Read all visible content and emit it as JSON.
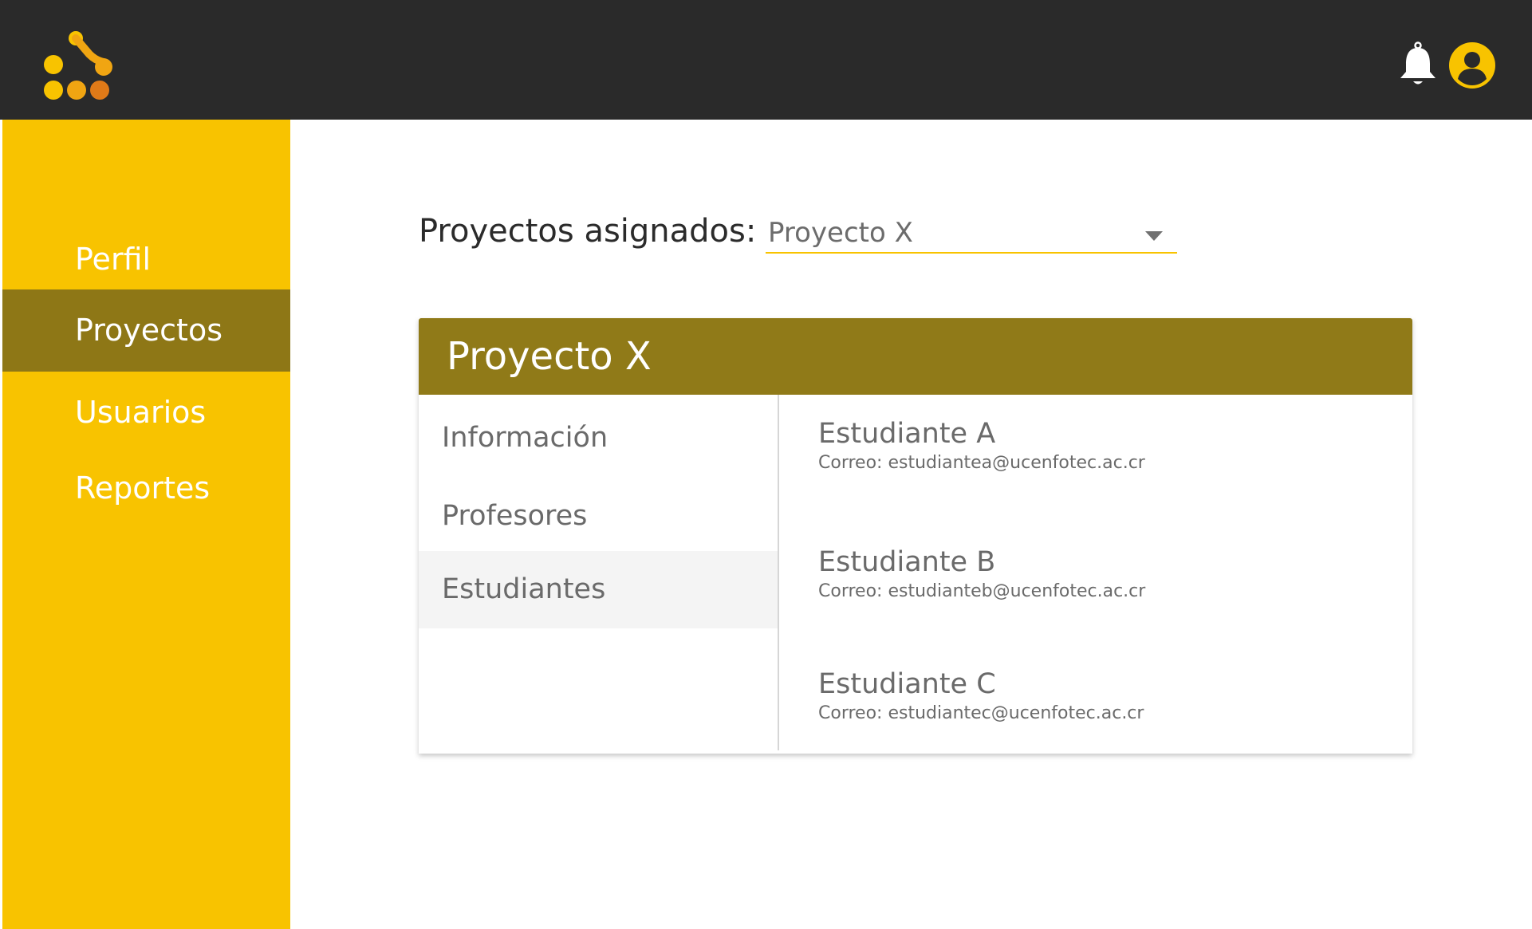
{
  "colors": {
    "topbar": "#2a2a2a",
    "sidebar": "#f8c300",
    "sidebar_active": "#8e7716",
    "card_header": "#907a18",
    "accent": "#f8c300"
  },
  "header": {
    "logo_icon": "app-logo-dots",
    "notification_icon": "bell-icon",
    "user_icon": "user-avatar-icon"
  },
  "sidebar": {
    "items": [
      {
        "label": "Perfil",
        "active": false
      },
      {
        "label": "Proyectos",
        "active": true
      },
      {
        "label": "Usuarios",
        "active": false
      },
      {
        "label": "Reportes",
        "active": false
      }
    ]
  },
  "main": {
    "projects_label": "Proyectos asignados:",
    "project_select": {
      "value": "Proyecto X",
      "icon": "caret-down-icon"
    }
  },
  "card": {
    "title": "Proyecto X",
    "tabs": [
      {
        "label": "Información",
        "active": false
      },
      {
        "label": "Profesores",
        "active": false
      },
      {
        "label": "Estudiantes",
        "active": true
      }
    ],
    "students": [
      {
        "name": "Estudiante A",
        "email": "Correo: estudiantea@ucenfotec.ac.cr"
      },
      {
        "name": "Estudiante B",
        "email": "Correo: estudianteb@ucenfotec.ac.cr"
      },
      {
        "name": "Estudiante C",
        "email": "Correo: estudiantec@ucenfotec.ac.cr"
      }
    ]
  }
}
